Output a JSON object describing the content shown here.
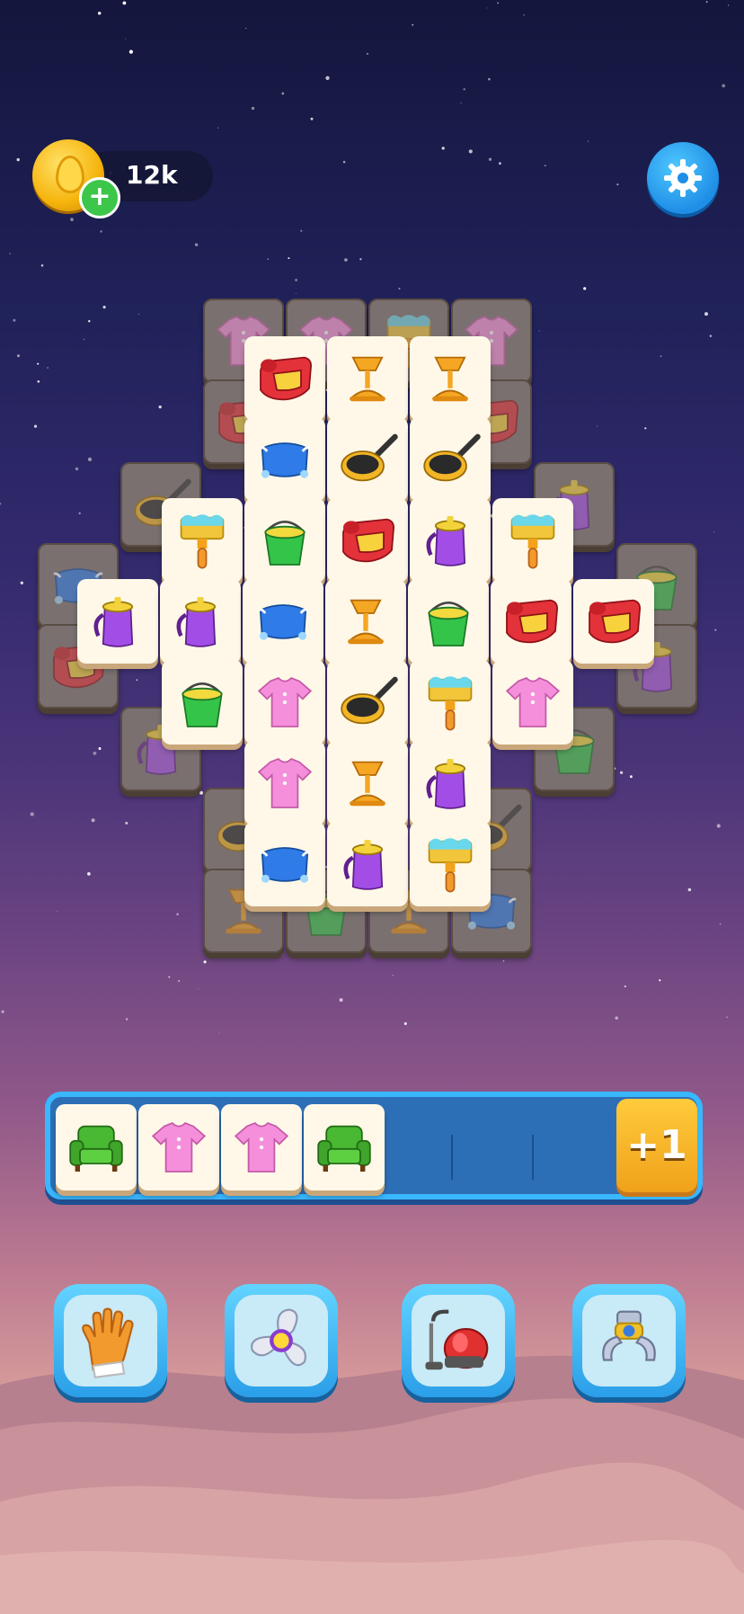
{
  "hud": {
    "coins": "12k",
    "plus": "+",
    "settings_icon": "gear-icon"
  },
  "board": {
    "bottom_layer": [
      "shirt",
      "shirt",
      "brush",
      "shirt",
      "mat",
      "mat",
      "pan",
      "pot",
      "pillow",
      "bucket",
      "mat",
      "pot",
      "pot",
      "bucket",
      "pan",
      "pan",
      "lamp",
      "bucket",
      "lamp",
      "pillow"
    ],
    "top_layer": [
      [
        "mat",
        "lamp",
        "lamp"
      ],
      [
        "pillow",
        "pan",
        "pan"
      ],
      [
        "brush",
        "bucket",
        "mat",
        "pot",
        "brush"
      ],
      [
        "pot",
        "pot",
        "pillow",
        "lamp",
        "bucket",
        "mat",
        "mat"
      ],
      [
        "bucket",
        "shirt",
        "pan",
        "brush",
        "shirt"
      ],
      [
        "shirt",
        "lamp",
        "pot"
      ],
      [
        "pillow",
        "pot",
        "brush"
      ]
    ]
  },
  "tray": {
    "slots": [
      "armchair",
      "shirt",
      "shirt",
      "armchair"
    ],
    "capacity": 7,
    "extra_slot_label": "+1"
  },
  "boosters": [
    {
      "name": "glove-icon"
    },
    {
      "name": "fan-icon"
    },
    {
      "name": "vacuum-icon"
    },
    {
      "name": "claw-icon"
    }
  ]
}
